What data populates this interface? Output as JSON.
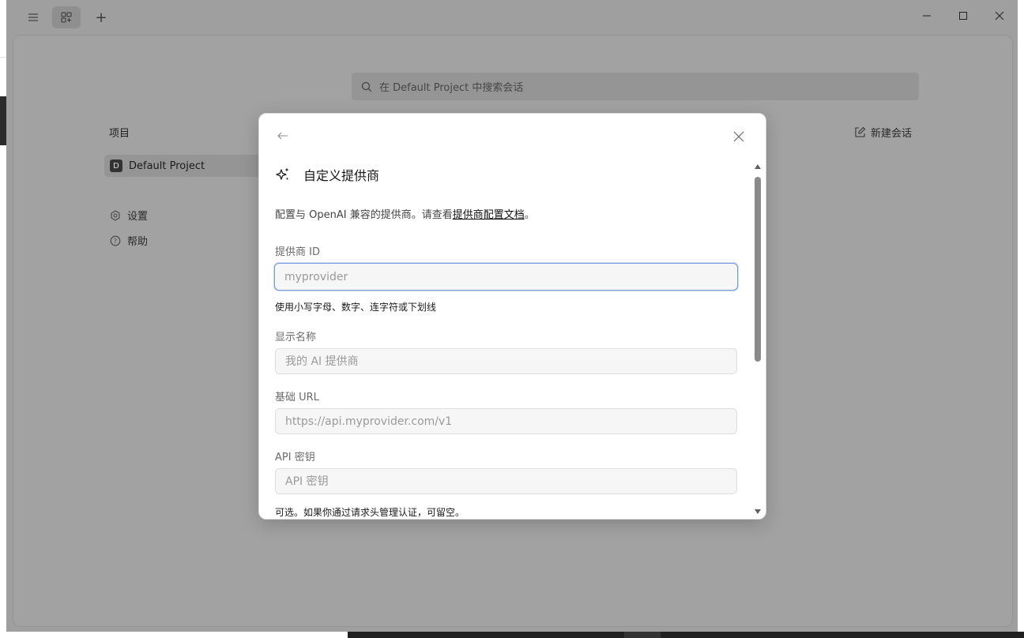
{
  "titlebar": {
    "menu_icon": "menu-icon",
    "grid_icon": "grid-icon",
    "plus_icon": "plus-icon",
    "plus_glyph": "+"
  },
  "search": {
    "placeholder": "在 Default Project 中搜索会话"
  },
  "sidebar": {
    "section_label": "项目",
    "project": {
      "badge": "D",
      "name": "Default Project"
    },
    "links": [
      {
        "label": "设置",
        "icon": "gear-icon"
      },
      {
        "label": "帮助",
        "icon": "help-icon"
      }
    ]
  },
  "header": {
    "new_chat_label": "新建会话"
  },
  "modal": {
    "title": "自定义提供商",
    "desc_prefix": "配置与 OpenAI 兼容的提供商。请查看",
    "desc_link": "提供商配置文档",
    "desc_suffix": "。",
    "fields": {
      "provider_id": {
        "label": "提供商 ID",
        "placeholder": "myprovider",
        "hint": "使用小写字母、数字、连字符或下划线"
      },
      "display_name": {
        "label": "显示名称",
        "placeholder": "我的 AI 提供商"
      },
      "base_url": {
        "label": "基础 URL",
        "placeholder": "https://api.myprovider.com/v1"
      },
      "api_key": {
        "label": "API 密钥",
        "placeholder": "API 密钥",
        "hint": "可选。如果你通过请求头管理认证，可留空。"
      }
    }
  },
  "colors": {
    "overlay": "#a2a2a2",
    "focus_border": "#7b9ad8",
    "modal_bg": "#ffffff"
  }
}
